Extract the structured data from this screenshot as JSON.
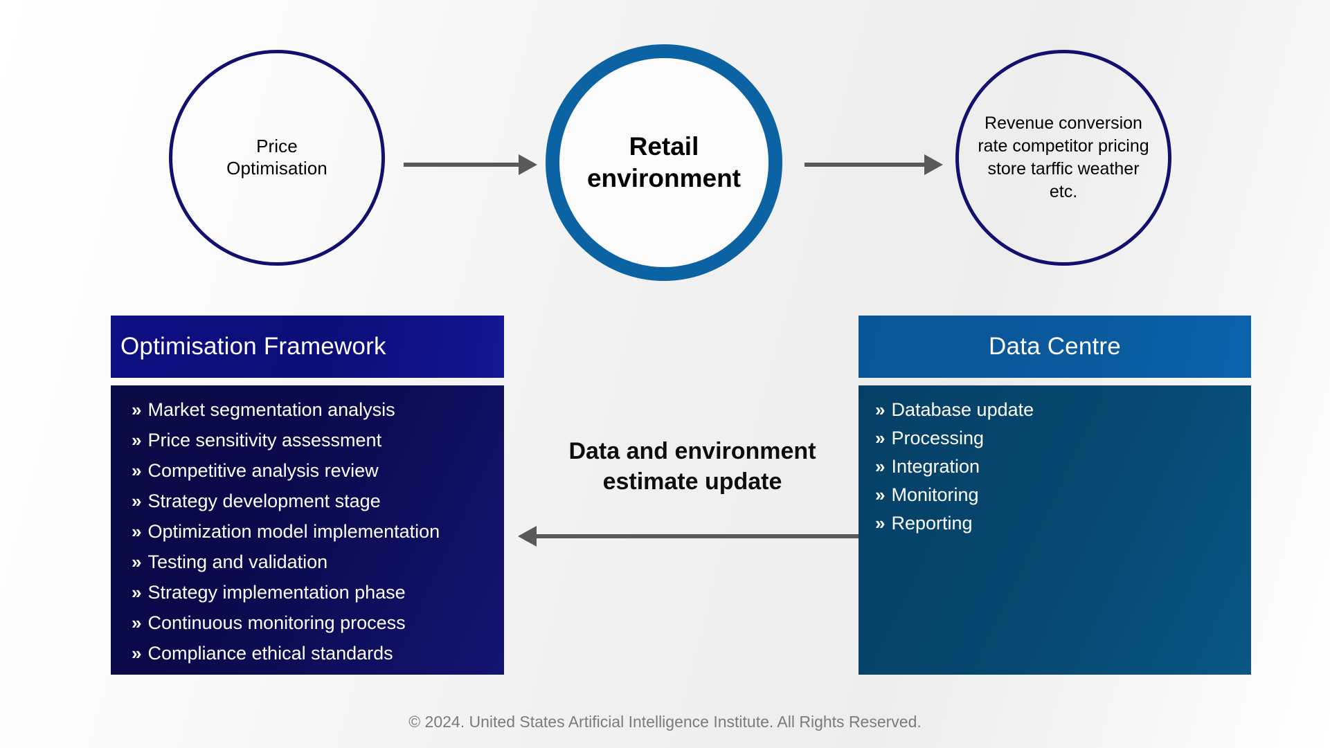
{
  "background": {
    "accent_navy": "#12106e",
    "accent_blue": "#0b63a4",
    "panel_navy_header": "#0d0f82",
    "panel_navy_body": "#0a0a4c",
    "panel_blue_header": "#0a5a9e",
    "panel_blue_body": "#064870",
    "arrow_color": "#595959"
  },
  "circles": {
    "price": {
      "label": "Price\nOptimisation"
    },
    "retail": {
      "label": "Retail\nenvironment"
    },
    "revenue": {
      "label": "Revenue conversion rate competitor pricing store tarffic weather etc."
    }
  },
  "flow": {
    "label": "Data and environment\nestimate update"
  },
  "panels": {
    "optimisation": {
      "title": "Optimisation Framework",
      "bullet": "»",
      "items": [
        "Market segmentation analysis",
        "Price sensitivity assessment",
        "Competitive analysis review",
        "Strategy development stage",
        "Optimization model implementation",
        "Testing and validation",
        "Strategy implementation phase",
        "Continuous monitoring process",
        "Compliance ethical standards"
      ]
    },
    "datacentre": {
      "title": "Data Centre",
      "bullet": "»",
      "items": [
        "Database update",
        "Processing",
        "Integration",
        "Monitoring",
        "Reporting"
      ]
    }
  },
  "footer": {
    "copyright": "© 2024. United States Artificial Intelligence Institute. All Rights Reserved."
  }
}
